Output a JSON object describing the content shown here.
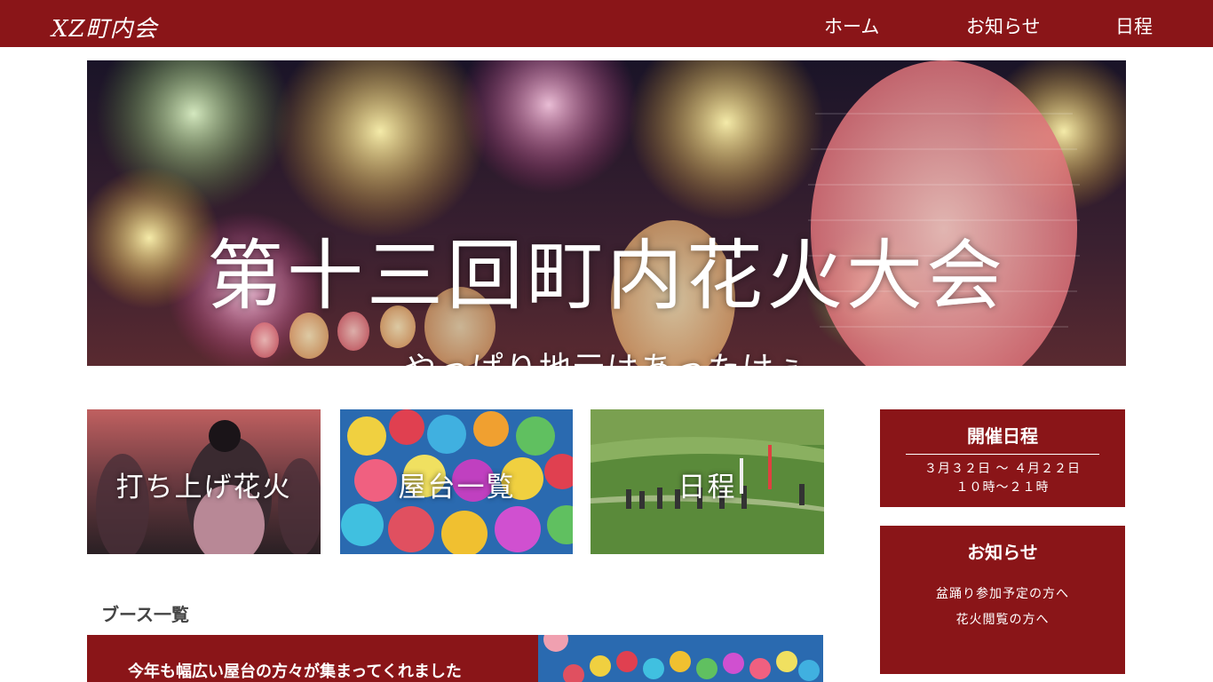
{
  "header": {
    "logo": "XZ町内会",
    "nav": [
      {
        "label": "ホーム"
      },
      {
        "label": "お知らせ"
      },
      {
        "label": "日程"
      }
    ]
  },
  "hero": {
    "title": "第十三回町内花火大会",
    "subtitle": "やっぱり地元はあったけぇ"
  },
  "cards": [
    {
      "label": "打ち上げ花火"
    },
    {
      "label": "屋台一覧"
    },
    {
      "label": "日程"
    }
  ],
  "schedule_box": {
    "title": "開催日程",
    "dates": "３月３２日 〜 ４月２２日",
    "hours": "１０時〜２１時"
  },
  "notice_box": {
    "title": "お知らせ",
    "links": [
      "盆踊り参加予定の方へ",
      "花火閲覧の方へ"
    ]
  },
  "booth_section": {
    "heading": "ブース一覧",
    "banner_text": "今年も幅広い屋台の方々が集まってくれました"
  },
  "colors": {
    "brand": "#8a1518",
    "text_on_brand": "#ffffff"
  }
}
